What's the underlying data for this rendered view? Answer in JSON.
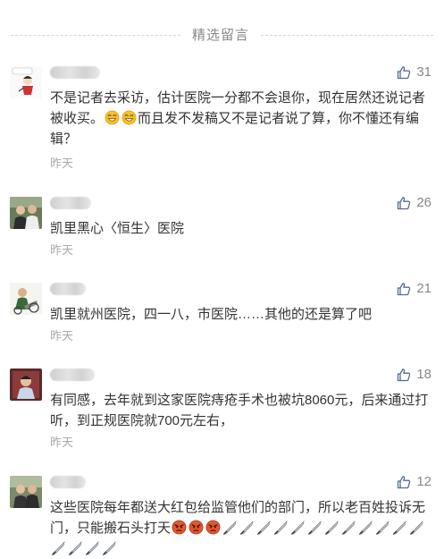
{
  "header": {
    "title": "精选留言"
  },
  "comments": [
    {
      "likes": "31",
      "text": "不是记者去采访，估计医院一分都不会退你，现在居然还说记者被收买。",
      "text_after": "而且发不发稿又不是记者说了算，你不懂还有编辑？",
      "time": "昨天"
    },
    {
      "likes": "26",
      "text": "凯里黑心〈恒生〉医院",
      "time": "昨天"
    },
    {
      "likes": "21",
      "text": "凯里就州医院，四一八，市医院……其他的还是算了吧",
      "time": "昨天"
    },
    {
      "likes": "18",
      "text": "有同感，去年就到这家医院痔疮手术也被坑8060元，后来通过打听，到正规医院就700元左右，",
      "time": "昨天"
    },
    {
      "likes": "12",
      "text": "这些医院每年都送大红包给监管他们的部门，所以老百姓投诉无门，只能搬石头打天"
    }
  ],
  "colors": {
    "accent_blue": "#576b95",
    "text_gray": "#888888"
  }
}
